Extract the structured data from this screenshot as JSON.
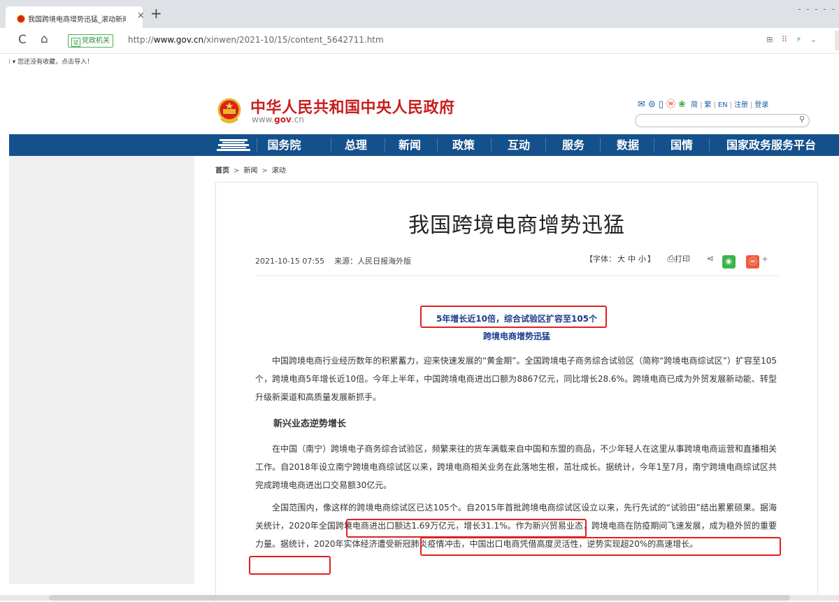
{
  "browser": {
    "tab_title": "我国跨境电商增势迅猛_滚动新闻",
    "tab_close": "×",
    "new_tab": "+",
    "window_hint": "- - - - -",
    "cert_label": "党政机关",
    "url_scheme": "http://",
    "url_host": "www.gov.cn",
    "url_path": "/xinwen/2021-10/15/content_5642711.htm",
    "bookmarks_text": "⁝ ▾  您还没有收藏，点击导入！"
  },
  "header": {
    "site_title": "中华人民共和国中央人民政府",
    "site_domain_prefix": "www.",
    "site_domain_gov": "gov",
    "site_domain_suffix": ".cn",
    "links": [
      "简",
      "繁",
      "EN",
      "注册",
      "登录"
    ]
  },
  "nav": {
    "items": [
      "国务院",
      "总理",
      "新闻",
      "政策",
      "互动",
      "服务",
      "数据",
      "国情",
      "国家政务服务平台"
    ]
  },
  "breadcrumb": {
    "items": [
      "首页",
      "新闻",
      "滚动"
    ],
    "separator": ">"
  },
  "article": {
    "title": "我国跨境电商增势迅猛",
    "datetime": "2021-10-15 07:55",
    "source_label": "来源：",
    "source": "人民日报海外版",
    "font_size_prefix": "【字体：",
    "font_sizes": [
      "大",
      "中",
      "小"
    ],
    "font_size_suffix": "】",
    "print_label": "打印",
    "plus": "+",
    "subhead1": "5年增长近10倍，综合试验区扩容至105个",
    "subhead2": "跨境电商增势迅猛",
    "para1": "中国跨境电商行业经历数年的积累蓄力，迎来快速发展的“黄金期”。全国跨境电子商务综合试验区（简称“跨境电商综试区”）扩容至105个，跨境电商5年增长近10倍。今年上半年，中国跨境电商进出口额为8867亿元，同比增长28.6%。跨境电商已成为外贸发展新动能、转型升级新渠道和高质量发展新抓手。",
    "heading2": "新兴业态逆势增长",
    "para2": "在中国（南宁）跨境电子商务综合试验区，频繁来往的货车满载来自中国和东盟的商品，不少年轻人在这里从事跨境电商运营和直播相关工作。自2018年设立南宁跨境电商综试区以来，跨境电商相关业务在此落地生根，茁壮成长。据统计，今年1至7月，南宁跨境电商综试区共完成跨境电商进出口交易额30亿元。",
    "para3": "全国范围内，像这样的跨境电商综试区已达105个。自2015年首批跨境电商综试区设立以来，先行先试的“试验田”结出累累硕果。据海关统计，2020年全国跨境电商进出口额达1.69万亿元，增长31.1%。作为新兴贸易业态，跨境电商在防疫期间飞速发展，成为稳外贸的重要力量。据统计，2020年实体经济遭受新冠肺炎疫情冲击，中国出口电商凭借高度灵活性，逆势实现超20%的高速增长。"
  },
  "icons": {
    "reload": "C",
    "home": "⌂",
    "mail": "✉",
    "rss": "⊜",
    "mobile": "▯",
    "weibo": "ⓦ",
    "wechat": "❀",
    "share": "⋖",
    "print": "⎙",
    "search": "⚲",
    "addr_grid": "⊞",
    "addr_apps": "⠿",
    "addr_bolt": "⚡",
    "addr_chevron": "⌄"
  },
  "colors": {
    "brand_red": "#c71f1f",
    "nav_blue": "#14508c",
    "highlight_red": "#e02020",
    "subhead_blue": "#1a3c8c"
  }
}
